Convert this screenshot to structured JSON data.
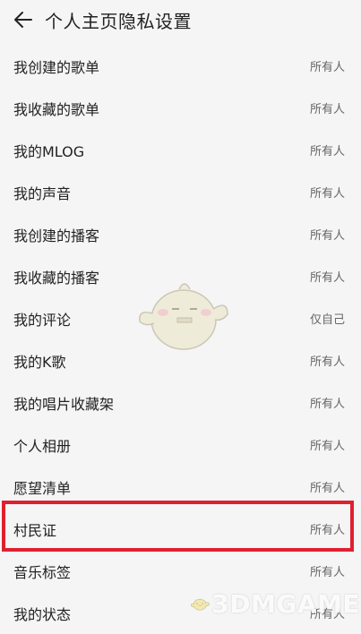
{
  "header": {
    "title": "个人主页隐私设置",
    "back_icon": "back-arrow-icon"
  },
  "settings": {
    "items": [
      {
        "label": "我创建的歌单",
        "value": "所有人"
      },
      {
        "label": "我收藏的歌单",
        "value": "所有人"
      },
      {
        "label": "我的MLOG",
        "value": "所有人"
      },
      {
        "label": "我的声音",
        "value": "所有人"
      },
      {
        "label": "我创建的播客",
        "value": "所有人"
      },
      {
        "label": "我收藏的播客",
        "value": "所有人"
      },
      {
        "label": "我的评论",
        "value": "仅自己"
      },
      {
        "label": "我的K歌",
        "value": "所有人"
      },
      {
        "label": "我的唱片收藏架",
        "value": "所有人"
      },
      {
        "label": "个人相册",
        "value": "所有人"
      },
      {
        "label": "愿望清单",
        "value": "所有人"
      },
      {
        "label": "村民证",
        "value": "所有人"
      },
      {
        "label": "音乐标签",
        "value": "所有人"
      },
      {
        "label": "我的状态",
        "value": "所有人"
      }
    ]
  },
  "watermark": {
    "text": "3DMGAME"
  },
  "colors": {
    "highlight_border": "#e0202f",
    "background": "#f5f5f5"
  }
}
